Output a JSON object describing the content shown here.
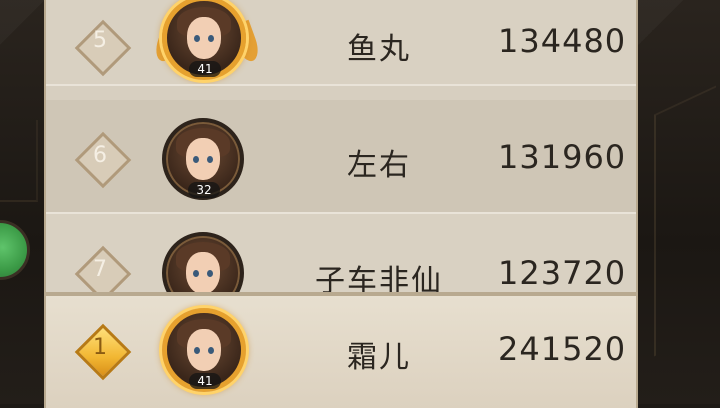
{
  "leaderboard": {
    "rows": [
      {
        "rank": "5",
        "name": "鱼丸",
        "score": "134480",
        "level": "41",
        "frame": "gold"
      },
      {
        "rank": "6",
        "name": "左右",
        "score": "131960",
        "level": "32",
        "frame": "normal"
      },
      {
        "rank": "7",
        "name": "子车非仙",
        "score": "123720",
        "level": "",
        "frame": "normal"
      }
    ],
    "self": {
      "rank": "1",
      "name": "霜儿",
      "score": "241520",
      "level": "41",
      "frame": "gold"
    }
  },
  "colors": {
    "panel": "#d7cfc0",
    "self_row": "#e2d8c6",
    "gold_frame": "#e6a12e",
    "side_button": "#3b9a46"
  },
  "icons": [
    "rank-diamond-icon",
    "avatar-portrait",
    "green-side-button-icon"
  ]
}
